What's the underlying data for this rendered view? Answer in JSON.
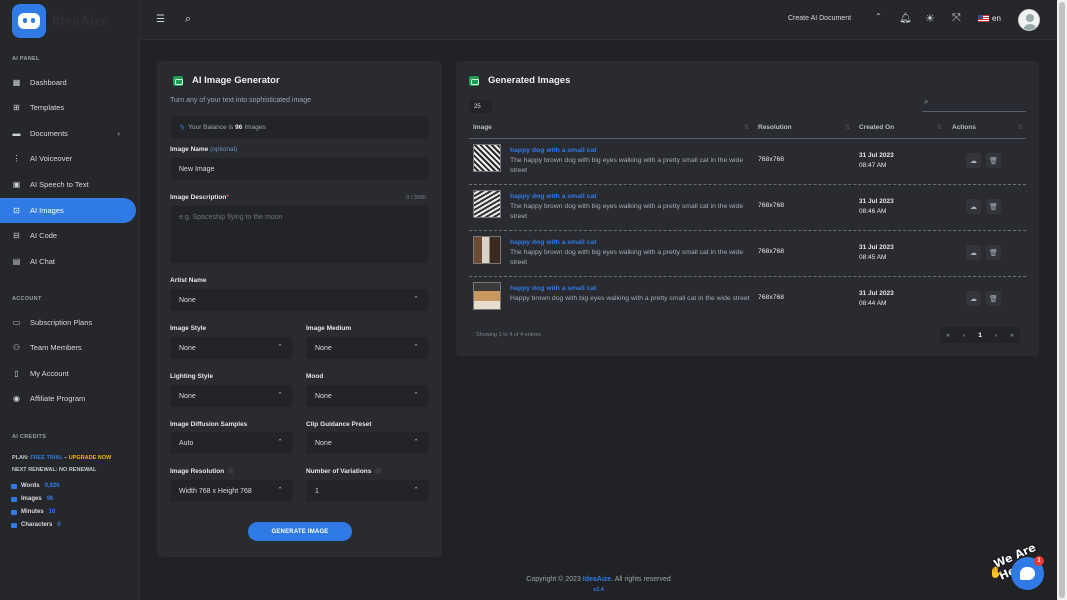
{
  "app": {
    "logo_text": "IdeaAize"
  },
  "header": {
    "create_document": "Create AI Document",
    "language": "en"
  },
  "sidebar": {
    "section_ai": "AI PANEL",
    "items": [
      {
        "label": "Dashboard",
        "icon": "dashboard-icon"
      },
      {
        "label": "Templates",
        "icon": "templates-icon"
      },
      {
        "label": "Documents",
        "icon": "documents-icon"
      },
      {
        "label": "AI Voiceover",
        "icon": "voiceover-icon"
      },
      {
        "label": "AI Speech to Text",
        "icon": "speech-icon"
      },
      {
        "label": "AI Images",
        "icon": "images-icon"
      },
      {
        "label": "AI Code",
        "icon": "code-icon"
      },
      {
        "label": "AI Chat",
        "icon": "chat-icon"
      }
    ],
    "section_account": "ACCOUNT",
    "account_items": [
      {
        "label": "Subscription Plans"
      },
      {
        "label": "Team Members"
      },
      {
        "label": "My Account"
      },
      {
        "label": "Affiliate Program"
      }
    ],
    "credits": {
      "heading": "AI CREDITS",
      "plan_prefix": "PLAN:",
      "plan_value": "FREE TRIAL",
      "plan_sep": " – ",
      "upgrade": "UPGRADE NOW",
      "renewal": "NEXT RENEWAL: NO RENEWAL",
      "rows": [
        {
          "label": "Words",
          "value": "9,826"
        },
        {
          "label": "Images",
          "value": "96"
        },
        {
          "label": "Minutes",
          "value": "10"
        },
        {
          "label": "Characters",
          "value": "0"
        }
      ]
    }
  },
  "generator": {
    "title": "AI Image Generator",
    "subtitle": "Turn any of your text into sophisticated image",
    "balance_prefix": "Your Balance is",
    "balance_value": "96",
    "balance_suffix": "Images",
    "image_name_label": "Image Name",
    "image_name_optional": "(optional)",
    "image_name_value": "New Image",
    "description_label": "Image Description",
    "description_required": "*",
    "description_counter": "0 / 3000",
    "description_placeholder": "e.g. Spaceship flying to the moon",
    "artist_label": "Artist Name",
    "artist_value": "None",
    "style_label": "Image Style",
    "style_value": "None",
    "medium_label": "Image Medium",
    "medium_value": "None",
    "lighting_label": "Lighting Style",
    "lighting_value": "None",
    "mood_label": "Mood",
    "mood_value": "None",
    "samples_label": "Image Diffusion Samples",
    "samples_value": "Auto",
    "clip_label": "Clip Guidance Preset",
    "clip_value": "None",
    "resolution_label": "Image Resolution",
    "resolution_value": "Width 768 x Height 768",
    "variations_label": "Number of Variations",
    "variations_value": "1",
    "generate_button": "GENERATE IMAGE"
  },
  "generated": {
    "title": "Generated Images",
    "entries_value": "25",
    "columns": [
      "Image",
      "Resolution",
      "Created On",
      "Actions"
    ],
    "rows": [
      {
        "title": "happy dog with a small cat",
        "desc": "The happy brown dog with big eyes walking with a pretty small cat in the wide street",
        "resolution": "768x768",
        "date": "31 Jul 2023",
        "time": "08:47 AM"
      },
      {
        "title": "happy dog with a small cat",
        "desc": "The happy brown dog with big eyes walking with a pretty small cat in the wide street",
        "resolution": "768x768",
        "date": "31 Jul 2023",
        "time": "08:46 AM"
      },
      {
        "title": "happy dog with a small cat",
        "desc": "The happy brown dog with big eyes walking with a pretty small cat in the wide street",
        "resolution": "768x768",
        "date": "31 Jul 2023",
        "time": "08:45 AM"
      },
      {
        "title": "happy dog with a small cat",
        "desc": "Happy brown dog with big eyes walking with a pretty small cat in the wide street",
        "resolution": "768x768",
        "date": "31 Jul 2023",
        "time": "08:44 AM"
      }
    ],
    "showing": "Showing 1 to 4 of 4 entries",
    "pager": [
      "«",
      "‹",
      "1",
      "›",
      "»"
    ]
  },
  "footer": {
    "prefix": "Copyright © 2023",
    "brand": "IdeaAize",
    "suffix": ". All rights reserved",
    "version": "v2.4"
  },
  "chat_widget": {
    "tagline": "We Are Here!",
    "badge": "1"
  },
  "colors": {
    "accent": "#2f7ae5",
    "background": "#212226",
    "card": "#2a2b30",
    "warning": "#f5b400"
  }
}
